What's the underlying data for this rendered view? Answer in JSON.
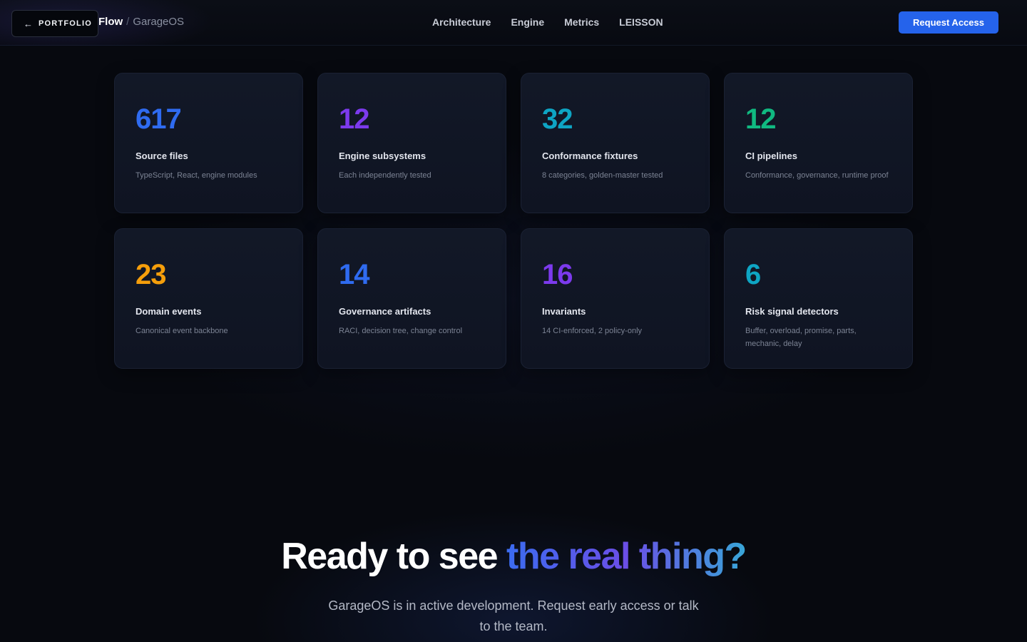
{
  "nav": {
    "back_label": "PORTFOLIO",
    "back_icon": "arrow-left-icon",
    "breadcrumb_root": "Flow",
    "breadcrumb_sep": "/",
    "breadcrumb_app": "GarageOS",
    "links": [
      "Architecture",
      "Engine",
      "Metrics",
      "LEISSON"
    ],
    "cta_label": "Request Access",
    "cta_color": "#2563eb"
  },
  "stats": [
    {
      "value": "617",
      "label": "Source files",
      "desc": "TypeScript, React, engine modules",
      "color": "#2f6bf0"
    },
    {
      "value": "12",
      "label": "Engine subsystems",
      "desc": "Each independently tested",
      "color": "#7c3aed"
    },
    {
      "value": "32",
      "label": "Conformance fixtures",
      "desc": "8 categories, golden-master tested",
      "color": "#0ea5c4"
    },
    {
      "value": "12",
      "label": "CI pipelines",
      "desc": "Conformance, governance, runtime proof",
      "color": "#10b981"
    },
    {
      "value": "23",
      "label": "Domain events",
      "desc": "Canonical event backbone",
      "color": "#f59e0b"
    },
    {
      "value": "14",
      "label": "Governance artifacts",
      "desc": "RACI, decision tree, change control",
      "color": "#2f6bf0"
    },
    {
      "value": "16",
      "label": "Invariants",
      "desc": "14 CI-enforced, 2 policy-only",
      "color": "#7c3aed"
    },
    {
      "value": "6",
      "label": "Risk signal detectors",
      "desc": "Buffer, overload, promise, parts, mechanic, delay",
      "color": "#0ea5c4"
    }
  ],
  "hero": {
    "title_plain": "Ready to see ",
    "title_accent": "the real thing?",
    "subtitle": "GarageOS is in active development. Request early access or talk to the team."
  }
}
